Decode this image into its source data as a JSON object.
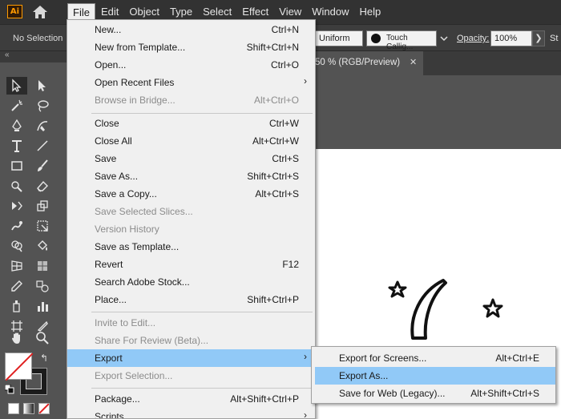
{
  "app": {
    "logo": "Ai"
  },
  "menubar": {
    "items": [
      "File",
      "Edit",
      "Object",
      "Type",
      "Select",
      "Effect",
      "View",
      "Window",
      "Help"
    ]
  },
  "controlbar": {
    "selection": "No Selection",
    "profile": "Uniform",
    "brush": "Touch Callig...",
    "opacity_label": "Opacity:",
    "opacity_value": "100%",
    "opacity_arrow": "❯",
    "style_label": "St"
  },
  "document": {
    "tab_title": "50 % (RGB/Preview)",
    "close": "✕"
  },
  "file_menu": {
    "items": [
      {
        "label": "New...",
        "shortcut": "Ctrl+N"
      },
      {
        "label": "New from Template...",
        "shortcut": "Shift+Ctrl+N"
      },
      {
        "label": "Open...",
        "shortcut": "Ctrl+O"
      },
      {
        "label": "Open Recent Files",
        "shortcut": "",
        "submenu": true
      },
      {
        "label": "Browse in Bridge...",
        "shortcut": "Alt+Ctrl+O",
        "disabled": true
      },
      {
        "label": "Close",
        "shortcut": "Ctrl+W"
      },
      {
        "label": "Close All",
        "shortcut": "Alt+Ctrl+W"
      },
      {
        "label": "Save",
        "shortcut": "Ctrl+S"
      },
      {
        "label": "Save As...",
        "shortcut": "Shift+Ctrl+S"
      },
      {
        "label": "Save a Copy...",
        "shortcut": "Alt+Ctrl+S"
      },
      {
        "label": "Save Selected Slices...",
        "shortcut": "",
        "disabled": true
      },
      {
        "label": "Version History",
        "shortcut": "",
        "disabled": true
      },
      {
        "label": "Save as Template...",
        "shortcut": ""
      },
      {
        "label": "Revert",
        "shortcut": "F12"
      },
      {
        "label": "Search Adobe Stock...",
        "shortcut": ""
      },
      {
        "label": "Place...",
        "shortcut": "Shift+Ctrl+P"
      },
      {
        "label": "Invite to Edit...",
        "shortcut": "",
        "disabled": true
      },
      {
        "label": "Share For Review (Beta)...",
        "shortcut": "",
        "disabled": true
      },
      {
        "label": "Export",
        "shortcut": "",
        "submenu": true,
        "highlighted": true
      },
      {
        "label": "Export Selection...",
        "shortcut": "",
        "disabled": true
      },
      {
        "label": "Package...",
        "shortcut": "Alt+Shift+Ctrl+P"
      },
      {
        "label": "Scripts",
        "shortcut": "",
        "submenu": true
      }
    ]
  },
  "export_submenu": {
    "items": [
      {
        "label": "Export for Screens...",
        "shortcut": "Alt+Ctrl+E"
      },
      {
        "label": "Export As...",
        "shortcut": "",
        "highlighted": true
      },
      {
        "label": "Save for Web (Legacy)...",
        "shortcut": "Alt+Shift+Ctrl+S"
      }
    ]
  },
  "colors": {
    "menu_highlight": "#91c9f7",
    "menu_bg": "#f0f0f0",
    "ui_dark": "#323232",
    "panel": "#535353",
    "logo_accent": "#ff9a00"
  },
  "icons": {
    "arrow": "›",
    "swap": "↰"
  },
  "tools": [
    "selection-tool",
    "direct-selection-tool",
    "magic-wand-tool",
    "lasso-tool",
    "pen-tool",
    "curvature-tool",
    "type-tool",
    "line-segment-tool",
    "rectangle-tool",
    "paintbrush-tool",
    "shaper-tool",
    "eraser-tool",
    "rotate-tool",
    "scale-tool",
    "warp-tool",
    "free-transform-tool",
    "shape-builder-tool",
    "live-paint-bucket-tool",
    "perspective-grid-tool",
    "mesh-tool",
    "gradient-tool",
    "eyedropper-tool",
    "blend-tool",
    "symbol-sprayer-tool",
    "column-graph-tool",
    "artboard-tool",
    "slice-tool",
    "hand-tool",
    "zoom-tool"
  ]
}
